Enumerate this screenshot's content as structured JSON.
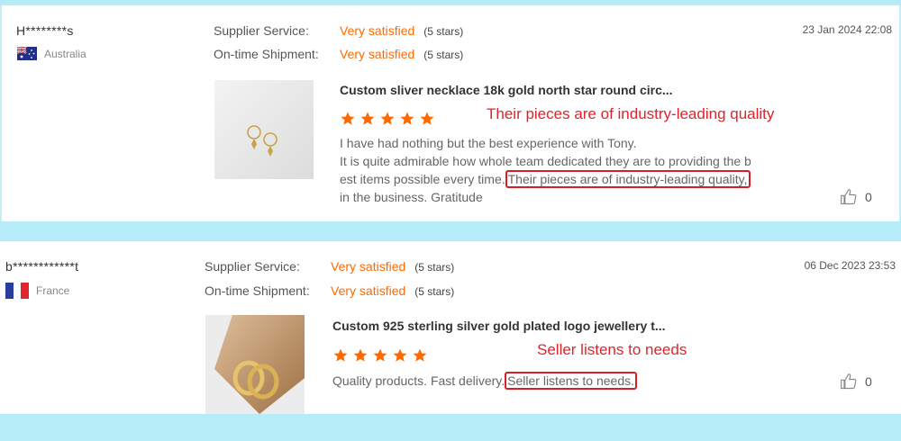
{
  "reviews": [
    {
      "reviewer": "H********s",
      "country": "Australia",
      "supplier_label": "Supplier Service:",
      "supplier_value": "Very satisfied",
      "supplier_stars": "(5 stars)",
      "shipment_label": "On-time Shipment:",
      "shipment_value": "Very satisfied",
      "shipment_stars": "(5 stars)",
      "date": "23 Jan 2024 22:08",
      "product_title": "Custom sliver necklace 18k gold north star round circ...",
      "rating": 5,
      "annotation": "Their pieces are of industry-leading quality",
      "review_line1": "I have had nothing but the best experience with Tony.",
      "review_line2": "It is quite admirable how whole team dedicated they are to providing the b",
      "review_line3_pre": "est items possible every time.",
      "review_highlight": "Their pieces are of industry-leading quality,",
      "review_line4": "in the business. Gratitude",
      "likes": "0"
    },
    {
      "reviewer": "b************t",
      "country": "France",
      "supplier_label": "Supplier Service:",
      "supplier_value": "Very satisfied",
      "supplier_stars": "(5 stars)",
      "shipment_label": "On-time Shipment:",
      "shipment_value": "Very satisfied",
      "shipment_stars": "(5 stars)",
      "date": "06 Dec 2023 23:53",
      "product_title": "Custom 925 sterling silver gold plated logo jewellery t...",
      "rating": 5,
      "annotation": "Seller listens to needs",
      "review_pre": "Quality products. Fast delivery.",
      "review_highlight": "Seller listens to needs.",
      "likes": "0"
    }
  ],
  "colors": {
    "accent": "#ff6a00",
    "annotation": "#e0232a",
    "background": "#b6ecf8"
  }
}
